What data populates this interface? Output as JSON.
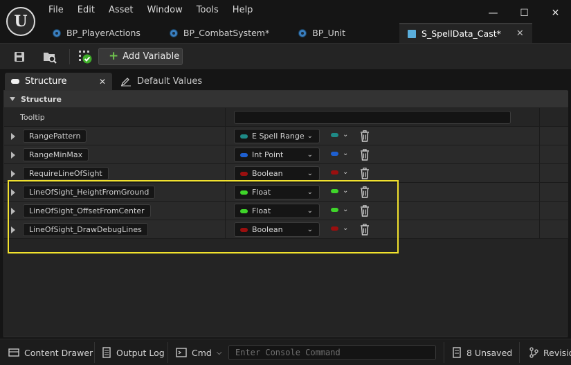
{
  "menu": [
    "File",
    "Edit",
    "Asset",
    "Window",
    "Tools",
    "Help"
  ],
  "window_controls": {
    "minimize": "—",
    "maximize": "☐",
    "close": "✕"
  },
  "doc_tabs": [
    {
      "label": "BP_PlayerActions",
      "icon": "blueprint-icon"
    },
    {
      "label": "BP_CombatSystem*",
      "icon": "blueprint-icon"
    },
    {
      "label": "BP_Unit",
      "icon": "blueprint-icon"
    },
    {
      "label": "S_SpellData_Cast*",
      "icon": "struct-icon",
      "active": true
    }
  ],
  "toolbar": {
    "add_variable_label": "Add Variable"
  },
  "panel_tabs": {
    "structure": "Structure",
    "default_values": "Default Values"
  },
  "section": {
    "title": "Structure",
    "tooltip_label": "Tooltip"
  },
  "rows": [
    {
      "name": "RangePattern",
      "type": "E Spell Range",
      "color": "#1e8a86"
    },
    {
      "name": "RangeMinMax",
      "type": "Int Point",
      "color": "#1e5fd0"
    },
    {
      "name": "RequireLineOfSight",
      "type": "Boolean",
      "color": "#9a0f0f"
    },
    {
      "name": "LineOfSight_HeightFromGround",
      "type": "Float",
      "color": "#3fd42a"
    },
    {
      "name": "LineOfSight_OffsetFromCenter",
      "type": "Float",
      "color": "#3fd42a"
    },
    {
      "name": "LineOfSight_DrawDebugLines",
      "type": "Boolean",
      "color": "#9a0f0f"
    }
  ],
  "statusbar": {
    "content_drawer": "Content Drawer",
    "output_log": "Output Log",
    "cmd": "Cmd",
    "console_placeholder": "Enter Console Command",
    "unsaved": "8 Unsaved",
    "revision": "Revisio"
  }
}
